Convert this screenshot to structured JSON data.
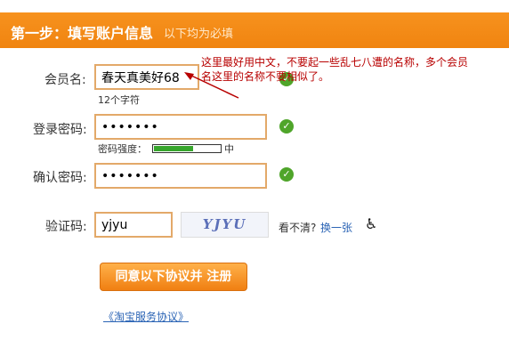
{
  "header": {
    "step_title": "第一步：填写账户信息",
    "note": "以下均为必填"
  },
  "member": {
    "label": "会员名:",
    "value": "春天真美好68",
    "hint": "12个字符"
  },
  "password": {
    "label": "登录密码:",
    "value": "•••••••",
    "strength_label": "密码强度：",
    "strength_level": "中",
    "strength_fill_fraction": 0.6
  },
  "confirm": {
    "label": "确认密码:",
    "value": "•••••••"
  },
  "captcha": {
    "label": "验证码:",
    "value": "yjyu",
    "image_text": "YJYU",
    "cant_see": "看不清?",
    "refresh_link": "换一张",
    "accessibility_icon": "wheelchair-icon"
  },
  "submit_label": "同意以下协议并 注册",
  "agreement_link": "《淘宝服务协议》",
  "annotation": {
    "line1": "这里最好用中文，不要起一些乱七八遭的名称，多个会员",
    "line2": "名这里的名称不要相似了。"
  },
  "colors": {
    "header": "#f28a16",
    "annotation": "#b80000",
    "ok": "#4fa52a",
    "link": "#2b64b5"
  }
}
